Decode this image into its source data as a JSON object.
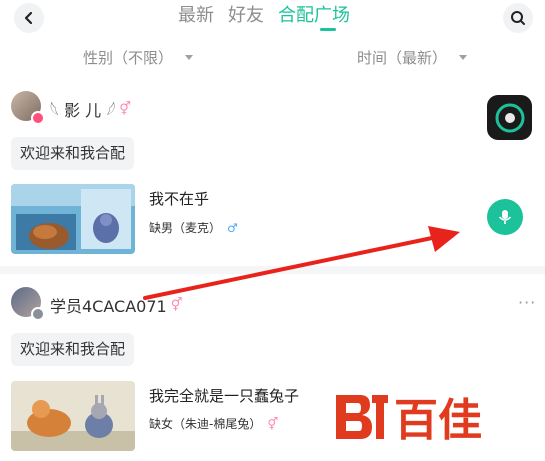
{
  "header": {
    "tabs": [
      {
        "label": "最新"
      },
      {
        "label": "好友"
      },
      {
        "label": "合配广场"
      }
    ]
  },
  "filters": {
    "gender": "性别（不限）",
    "time": "时间（最新）"
  },
  "posts": [
    {
      "username": "𓆩 影 儿 𓆪",
      "greeting": "欢迎来和我合配",
      "work_title": "我不在乎",
      "role": "缺男（麦克）",
      "gender_symbol": "♂"
    },
    {
      "username": "学员4CACA071",
      "greeting": "欢迎来和我合配",
      "work_title": "我完全就是一只蠢兔子",
      "role": "缺女（朱迪-棉尾兔）",
      "gender_symbol": "⚥"
    }
  ],
  "watermark": {
    "text": "百佳"
  },
  "colors": {
    "accent": "#1bc29a",
    "annotation_arrow": "#e8231c"
  },
  "icons": {
    "back": "chevron-left-icon",
    "search": "search-icon",
    "mic": "microphone-icon",
    "more": "more-horizontal-icon"
  }
}
